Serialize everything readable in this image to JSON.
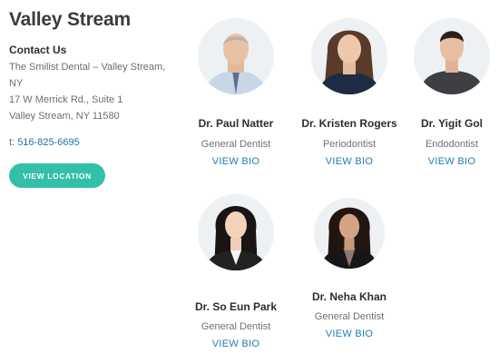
{
  "location": {
    "title": "Valley Stream",
    "contact_heading": "Contact Us",
    "address_line1": "The Smilist Dental – Valley Stream,",
    "address_line2": "NY",
    "address_line3": "17 W Merrick Rd., Suite 1",
    "address_line4": "Valley Stream, NY 11580",
    "phone_prefix": "t:",
    "phone": "516-825-6695",
    "button_label": "VIEW LOCATION",
    "accent_color": "#34bfa8"
  },
  "doctors": [
    {
      "name": "Dr. Paul Natter",
      "role": "General Dentist",
      "bio_label": "VIEW BIO"
    },
    {
      "name": "Dr. Kristen Rogers",
      "role": "Periodontist",
      "bio_label": "VIEW BIO"
    },
    {
      "name": "Dr. Yigit Gol",
      "role": "Endodontist",
      "bio_label": "VIEW BIO"
    },
    {
      "name": "Dr. So Eun Park",
      "role": "General Dentist",
      "bio_label": "VIEW BIO"
    },
    {
      "name": "Dr. Neha Khan",
      "role": "General Dentist",
      "bio_label": "VIEW BIO"
    }
  ]
}
